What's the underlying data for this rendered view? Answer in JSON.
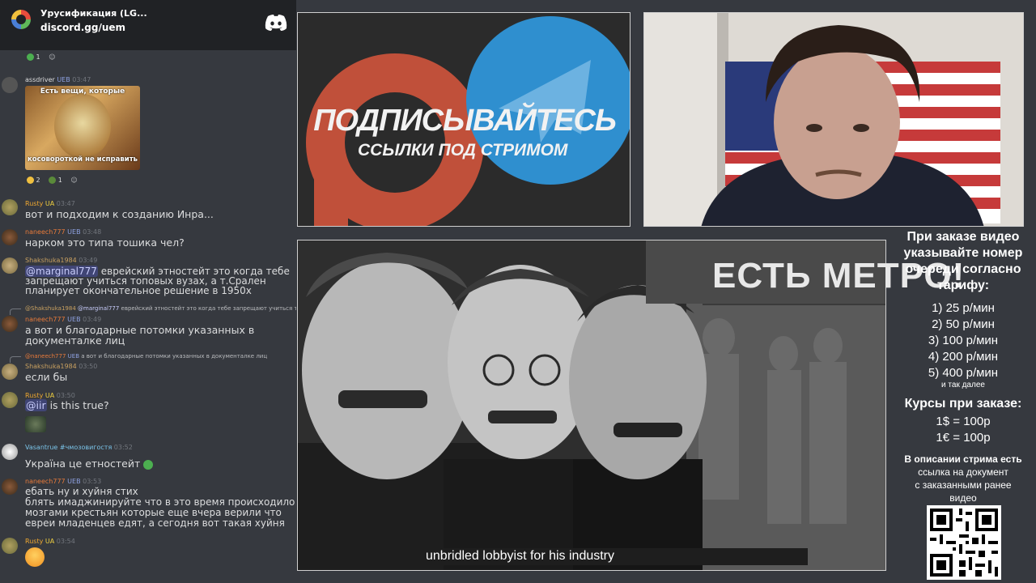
{
  "server": {
    "name": "Урусификация (LG...",
    "invite": "discord.gg/uem"
  },
  "messages": [
    {
      "user": "",
      "time": "",
      "text": "",
      "reactions": [
        "1"
      ]
    },
    {
      "user": "assdriver",
      "badge": "UEB",
      "time": "03:47",
      "image_caption_top": "Есть вещи, которые",
      "image_caption_bottom": "косовороткой не исправить",
      "reactions": [
        "2",
        "1"
      ]
    },
    {
      "user": "Rusty",
      "badge": "UA",
      "time": "03:47",
      "text": "вот и подходим к созданию Инра..."
    },
    {
      "user": "naneech777",
      "badge": "UEB",
      "time": "03:48",
      "text": "нарком это типа тошика чел?"
    },
    {
      "user": "Shakshuka1984",
      "time": "03:49",
      "mention": "@marginal777",
      "text_line1": " еврейский этностейт это когда тебе",
      "text_line2": "запрещают учиться топовых вузах, а т.Срален",
      "text_line3": "планирует окончательное решение в 1950х"
    },
    {
      "reply_user": "@Shakshuka1984",
      "reply_mention": "@marginal777",
      "reply_text": " еврейский этностейт это когда тебе запрещают учиться топовых",
      "user": "naneech777",
      "badge": "UEB",
      "time": "03:49",
      "text_line1": "а вот и благодарные потомки указанных в",
      "text_line2": "документалке лиц"
    },
    {
      "reply_user": "@naneech777",
      "reply_badge": "UEB",
      "reply_text": "а вот и благодарные потомки указанных в документалке лиц",
      "user": "Shakshuka1984",
      "time": "03:50",
      "text": "если бы"
    },
    {
      "user": "Rusty",
      "badge": "UA",
      "time": "03:50",
      "mention": "@iir",
      "text": " is this true?"
    },
    {
      "user": "Vasantrue",
      "badge": "#чмозовигостя",
      "time": "03:52",
      "text": "Україна це етностейт"
    },
    {
      "user": "naneech777",
      "badge": "UEB",
      "time": "03:53",
      "text_line1": "ебать ну и хуйня стих",
      "text_line2": "блять имаджинируйте что в это время происходило с",
      "text_line3": "мозгами крестьян которые еще вчера верили что",
      "text_line4": "евреи младенцев едят, а сегодня вот такая хуйня"
    },
    {
      "user": "Rusty",
      "badge": "UA",
      "time": "03:54",
      "text": ""
    }
  ],
  "banner": {
    "title": "ПОДПИСЫВАЙТЕСЬ",
    "subtitle": "ССЫЛКИ ПОД СТРИМОМ"
  },
  "video": {
    "sign": "ЕСТЬ МЕТРО!",
    "subtitle": "unbridled lobbyist for his industry"
  },
  "info": {
    "order_lines": [
      "При заказе видео",
      "указывайте номер",
      "очереди согласно",
      "тарифу:"
    ],
    "tariffs": [
      "1) 25 р/мин",
      "2) 50 р/мин",
      "3) 100 р/мин",
      "4) 200 р/мин",
      "5) 400 р/мин"
    ],
    "and_more": "и так далее",
    "rates_title": "Курсы при заказе:",
    "rates": [
      "1$ = 100р",
      "1€ = 100р"
    ],
    "desc_lines": [
      "В описании стрима есть",
      "ссылка на документ",
      "с заказанными ранее",
      "видео"
    ]
  },
  "colors": {
    "chat_bg": "#36393f",
    "header_bg": "#202225",
    "user_rusty": "#f0a830",
    "user_naneech": "#e87a3a",
    "user_shakshuka": "#c8a060",
    "user_vasantrue": "#7ac3e8",
    "user_assdriver": "#dcddde",
    "telegram": "#2f8fcf",
    "patreon": "#c0503a"
  }
}
